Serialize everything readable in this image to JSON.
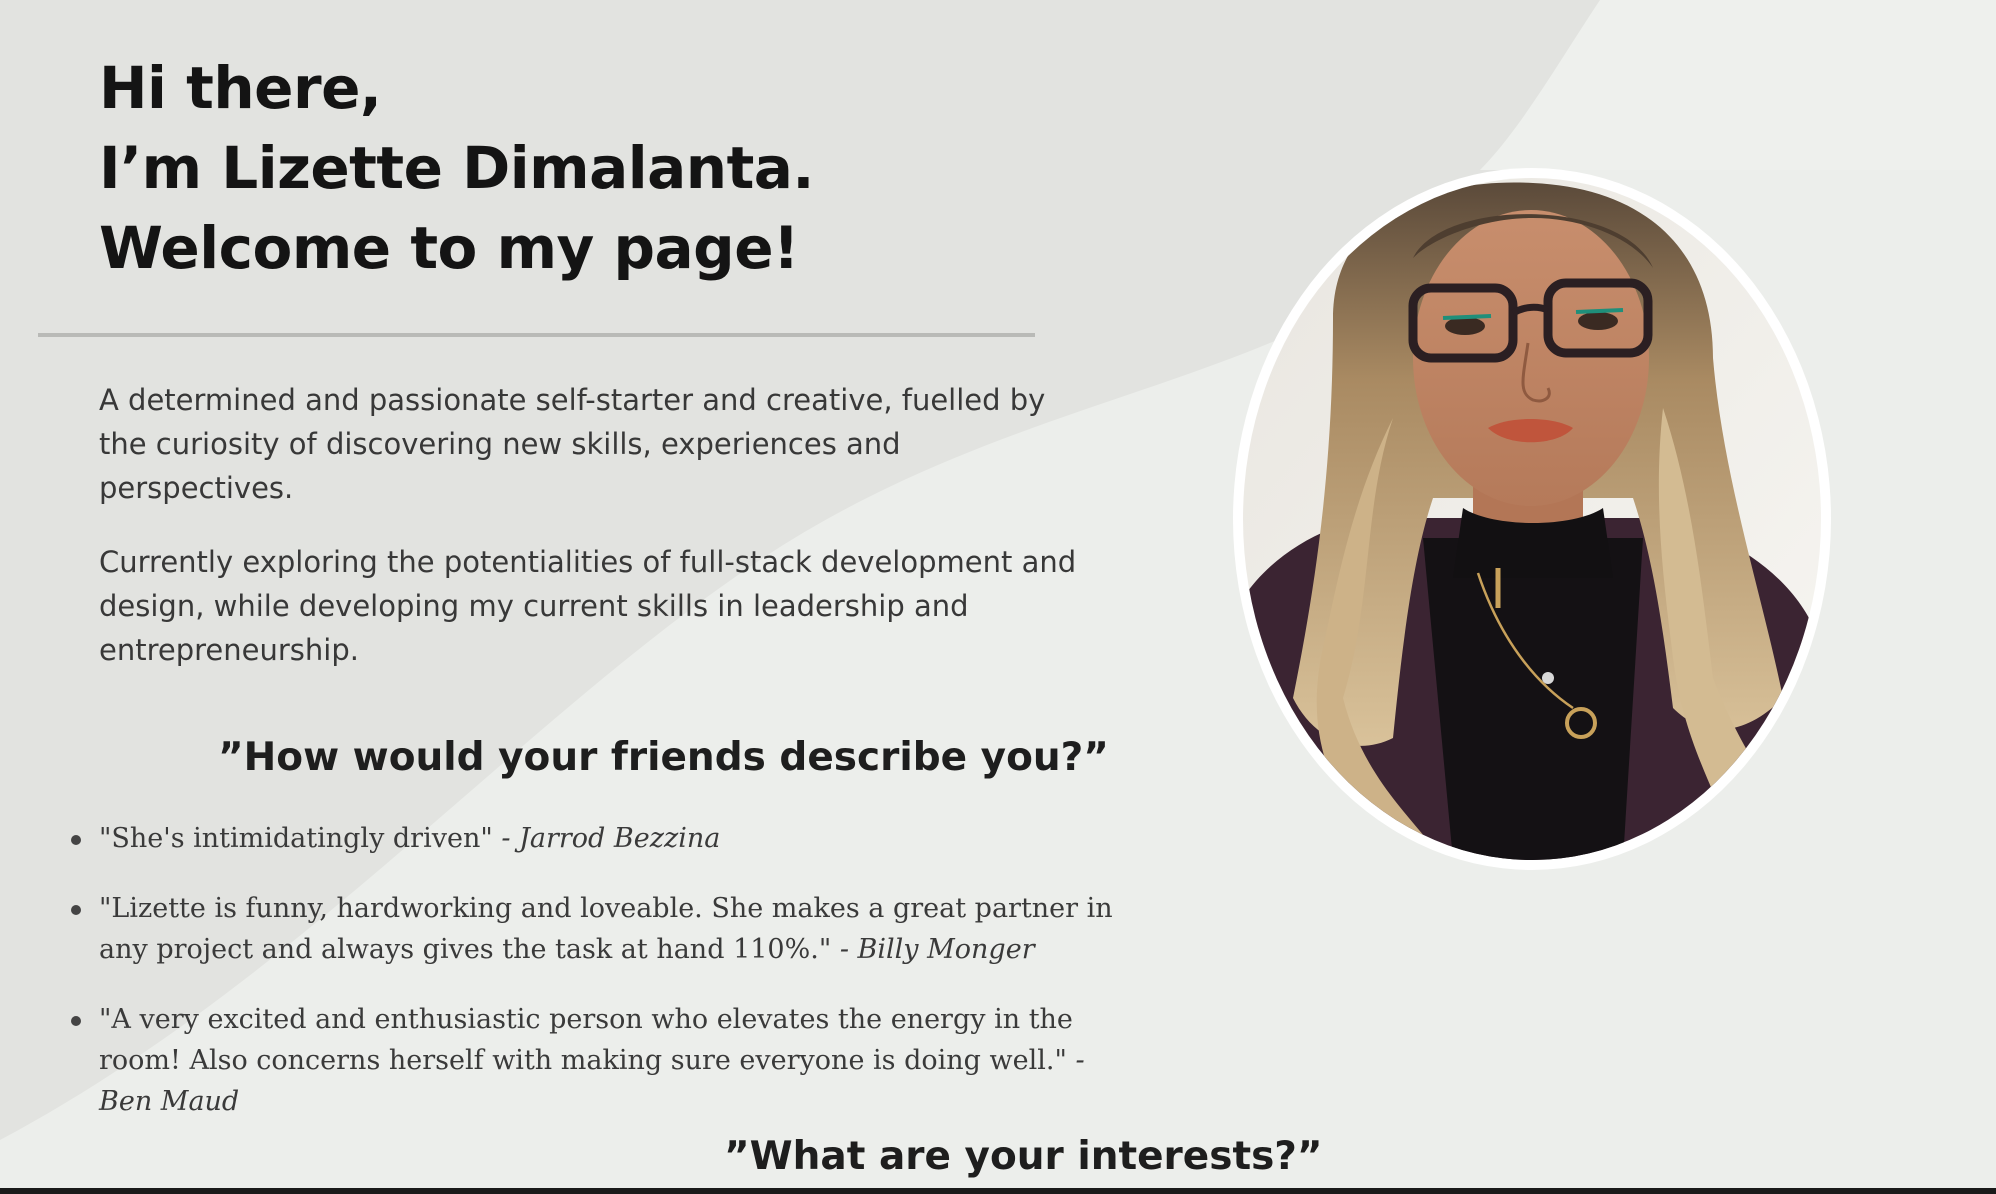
{
  "header": {
    "greeting_line1": "Hi there,",
    "greeting_line2": "I’m Lizette Dimalanta.",
    "greeting_line3": "Welcome to my page!"
  },
  "bio": {
    "paragraph1": "A determined and passionate self-starter and creative, fuelled by the curiosity of discovering new skills, experiences and perspectives.",
    "paragraph2": "Currently exploring the potentialities of full-stack development and design, while developing my current skills in leadership and entrepreneurship."
  },
  "friends_section": {
    "heading": "”How would your friends describe you?”",
    "quotes": [
      {
        "text": "\"She's intimidatingly driven\"",
        "author": " - Jarrod Bezzina"
      },
      {
        "text": "\"Lizette is funny, hardworking and loveable. She makes a great partner in any project and always gives the task at hand 110%.\"",
        "author": " - Billy Monger"
      },
      {
        "text": "\"A very excited and enthusiastic person who elevates the energy in the room! Also concerns herself with making sure everyone is doing well.\"",
        "author": " - Ben Maud"
      }
    ]
  },
  "interests_section": {
    "heading": "”What are your interests?”"
  },
  "colors": {
    "background": "#e3e4e1",
    "background_light": "#eff0ee",
    "text_dark": "#141414",
    "divider": "#b9bab7",
    "portrait_border": "#ffffff"
  }
}
